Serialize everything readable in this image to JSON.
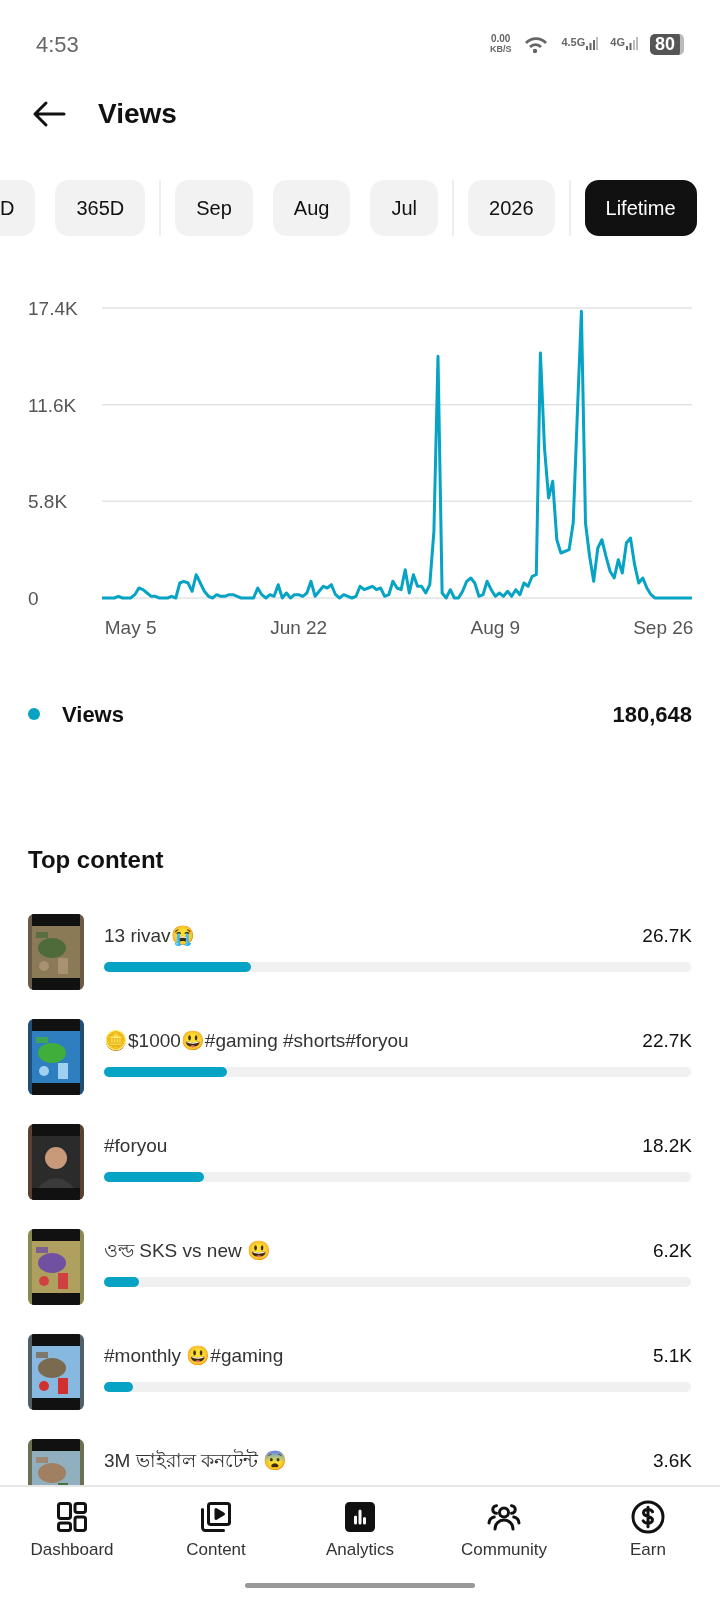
{
  "status_bar": {
    "time": "4:53",
    "speed_value": "0.00",
    "speed_unit": "KB/S",
    "network_1": "4.5G",
    "network_2": "4G",
    "battery": "80"
  },
  "header": {
    "title": "Views"
  },
  "chip_groups": [
    {
      "chips": [
        {
          "label": "D",
          "selected": false
        },
        {
          "label": "365D",
          "selected": false
        }
      ]
    },
    {
      "chips": [
        {
          "label": "Sep",
          "selected": false
        },
        {
          "label": "Aug",
          "selected": false
        },
        {
          "label": "Jul",
          "selected": false
        }
      ]
    },
    {
      "chips": [
        {
          "label": "2026",
          "selected": false
        }
      ]
    },
    {
      "chips": [
        {
          "label": "Lifetime",
          "selected": true
        }
      ]
    }
  ],
  "chart_data": {
    "type": "line",
    "ylim": [
      0,
      17400
    ],
    "categories": [
      null,
      null,
      null,
      null,
      null,
      null,
      null,
      "May 5",
      null,
      null,
      null,
      null,
      null,
      null,
      null,
      null,
      null,
      null,
      null,
      null,
      null,
      null,
      null,
      null,
      null,
      null,
      null,
      null,
      null,
      null,
      null,
      null,
      null,
      null,
      null,
      null,
      null,
      null,
      null,
      null,
      null,
      null,
      null,
      null,
      null,
      null,
      null,
      null,
      "Jun 22",
      null,
      null,
      null,
      null,
      null,
      null,
      null,
      null,
      null,
      null,
      null,
      null,
      null,
      null,
      null,
      null,
      null,
      null,
      null,
      null,
      null,
      null,
      null,
      null,
      null,
      null,
      null,
      null,
      null,
      null,
      null,
      null,
      null,
      null,
      null,
      null,
      null,
      null,
      null,
      null,
      null,
      null,
      null,
      null,
      null,
      null,
      null,
      "Aug 9",
      null,
      null,
      null,
      null,
      null,
      null,
      null,
      null,
      null,
      null,
      null,
      null,
      null,
      null,
      null,
      null,
      null,
      null,
      null,
      null,
      null,
      null,
      null,
      null,
      null,
      null,
      null,
      null,
      null,
      null,
      null,
      null,
      null,
      null,
      null,
      null,
      null,
      null,
      null,
      null,
      "Sep 26",
      null,
      null,
      null,
      null,
      null,
      null,
      null
    ],
    "yticks": [
      {
        "value": 0,
        "label": "0"
      },
      {
        "value": 5800,
        "label": "5.8K"
      },
      {
        "value": 11600,
        "label": "11.6K"
      },
      {
        "value": 17400,
        "label": "17.4K"
      }
    ],
    "series": [
      {
        "name": "Views",
        "color": "#06a3c4",
        "values": [
          0,
          0,
          0,
          0,
          100,
          0,
          0,
          0,
          200,
          600,
          500,
          300,
          100,
          100,
          0,
          0,
          0,
          100,
          0,
          900,
          1000,
          900,
          400,
          1400,
          900,
          400,
          100,
          0,
          200,
          100,
          100,
          200,
          200,
          100,
          0,
          0,
          0,
          0,
          600,
          200,
          0,
          200,
          100,
          800,
          0,
          300,
          0,
          200,
          200,
          100,
          300,
          1000,
          100,
          400,
          700,
          600,
          800,
          200,
          0,
          200,
          100,
          0,
          100,
          700,
          500,
          600,
          700,
          500,
          600,
          100,
          200,
          1000,
          600,
          500,
          1700,
          300,
          1400,
          700,
          700,
          300,
          800,
          4000,
          14500,
          300,
          0,
          500,
          0,
          0,
          400,
          1000,
          1200,
          900,
          100,
          200,
          1000,
          500,
          100,
          300,
          100,
          400,
          100,
          500,
          200,
          900,
          700,
          1300,
          1400,
          14700,
          9000,
          6000,
          7000,
          3500,
          2700,
          2800,
          2900,
          4500,
          11000,
          17200,
          4500,
          2500,
          1000,
          3000,
          3500,
          2500,
          1600,
          1200,
          2300,
          1500,
          3300,
          3600,
          2000,
          900,
          1200,
          600,
          200,
          0,
          0,
          0,
          0,
          0,
          0,
          0,
          0,
          0,
          0
        ]
      }
    ]
  },
  "legend": {
    "value": "180,648"
  },
  "top_content": {
    "title": "Top content",
    "items": [
      {
        "title": "13 rivav😭",
        "value": "26.7K",
        "level": 0.25
      },
      {
        "title": "🪙$1000😃#gaming #shorts#foryou",
        "value": "22.7K",
        "level": 0.21
      },
      {
        "title": "#foryou",
        "value": "18.2K",
        "level": 0.17
      },
      {
        "title": "ওল্ড SKS vs new 😃",
        "value": "6.2K",
        "level": 0.06
      },
      {
        "title": "#monthly 😃#gaming",
        "value": "5.1K",
        "level": 0.05
      },
      {
        "title": "3M ভাইরাল কনটেন্ট 😨",
        "value": "3.6K"
      }
    ]
  },
  "bottom_nav": [
    {
      "label": "Dashboard",
      "kind": "dashboard",
      "selected": false
    },
    {
      "label": "Content",
      "kind": "content",
      "selected": false
    },
    {
      "label": "Analytics",
      "kind": "analytics",
      "selected": true
    },
    {
      "label": "Community",
      "kind": "community",
      "selected": false
    },
    {
      "label": "Earn",
      "kind": "earn",
      "selected": false
    }
  ]
}
